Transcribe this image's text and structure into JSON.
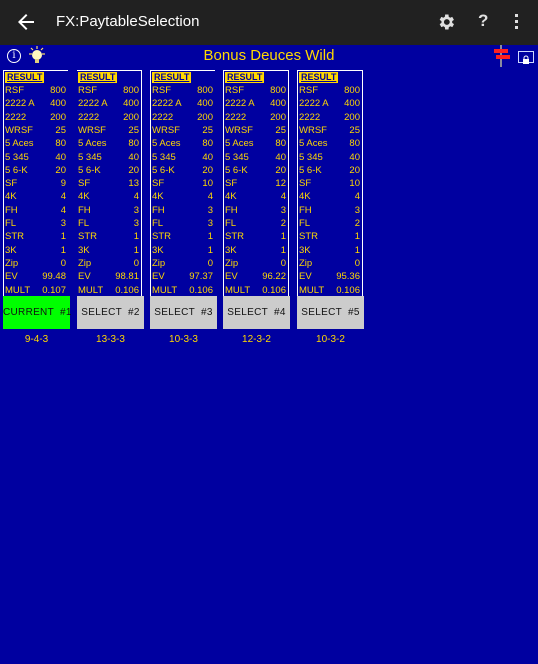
{
  "appbar": {
    "title": "FX:PaytableSelection",
    "help_label": "?"
  },
  "toolbar": {
    "info_label": "i",
    "game_title": "Bonus Deuces Wild"
  },
  "colors": {
    "background": "#0000a0",
    "appbar": "#212121",
    "text_yellow": "#ffd800",
    "current_button": "#00ff00",
    "select_button": "#cccccc"
  },
  "result_header": "RESULT",
  "row_labels": [
    "RSF",
    "2222 A",
    "2222",
    "WRSF",
    "5 Aces",
    "5 345",
    "5 6-K",
    "SF",
    "4K",
    "FH",
    "FL",
    "STR",
    "3K",
    "Zip",
    "EV",
    "MULT"
  ],
  "paytables": [
    {
      "values": [
        "800",
        "400",
        "200",
        "25",
        "80",
        "40",
        "20",
        "9",
        "4",
        "4",
        "3",
        "1",
        "1",
        "0",
        "99.48",
        "0.107"
      ],
      "button_label": "CURRENT  #1",
      "is_current": true,
      "combo": "9-4-3"
    },
    {
      "values": [
        "800",
        "400",
        "200",
        "25",
        "80",
        "40",
        "20",
        "13",
        "4",
        "3",
        "3",
        "1",
        "1",
        "0",
        "98.81",
        "0.106"
      ],
      "button_label": "SELECT  #2",
      "is_current": false,
      "combo": "13-3-3"
    },
    {
      "values": [
        "800",
        "400",
        "200",
        "25",
        "80",
        "40",
        "20",
        "10",
        "4",
        "3",
        "3",
        "1",
        "1",
        "0",
        "97.37",
        "0.106"
      ],
      "button_label": "SELECT  #3",
      "is_current": false,
      "combo": "10-3-3"
    },
    {
      "values": [
        "800",
        "400",
        "200",
        "25",
        "80",
        "40",
        "20",
        "12",
        "4",
        "3",
        "2",
        "1",
        "1",
        "0",
        "96.22",
        "0.106"
      ],
      "button_label": "SELECT  #4",
      "is_current": false,
      "combo": "12-3-2"
    },
    {
      "values": [
        "800",
        "400",
        "200",
        "25",
        "80",
        "40",
        "20",
        "10",
        "4",
        "3",
        "2",
        "1",
        "1",
        "0",
        "95.36",
        "0.106"
      ],
      "button_label": "SELECT  #5",
      "is_current": false,
      "combo": "10-3-2"
    }
  ]
}
